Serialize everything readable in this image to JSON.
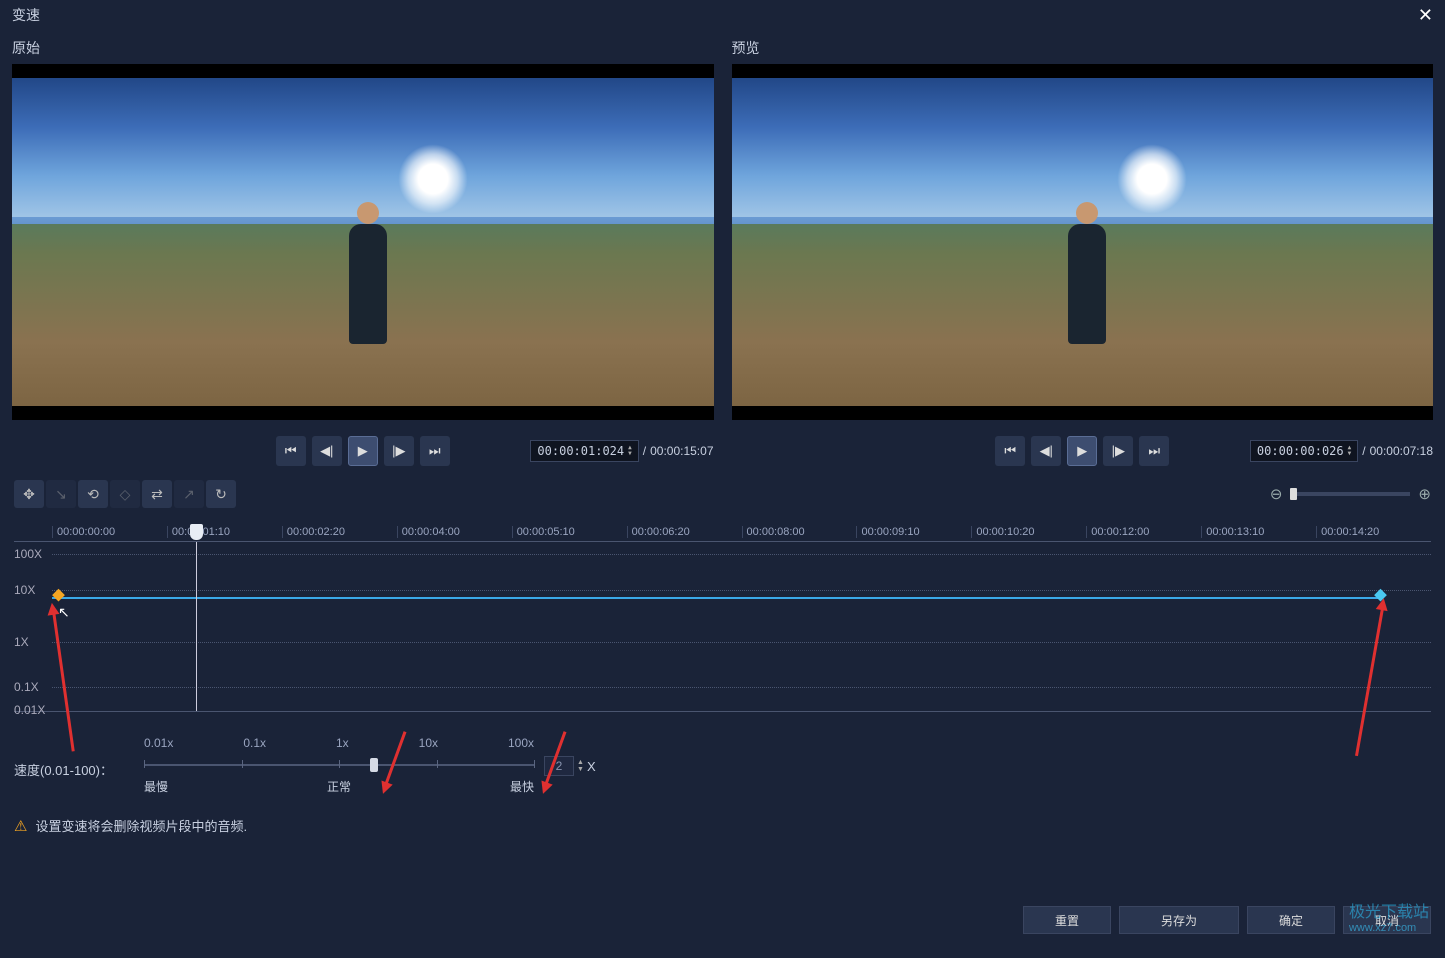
{
  "dialog": {
    "title": "变速",
    "close": "✕"
  },
  "panels": {
    "original_label": "原始",
    "preview_label": "预览"
  },
  "playback": {
    "original": {
      "tc": "00:00:01:024",
      "duration": "00:00:15:07"
    },
    "preview": {
      "tc": "00:00:00:026",
      "duration": "00:00:07:18"
    }
  },
  "toolbar_icons": [
    "✥",
    "↘",
    "⟲",
    "◇",
    "⇄",
    "↗",
    "↻"
  ],
  "ruler": [
    "00:00:00:00",
    "00:00:01:10",
    "00:00:02:20",
    "00:00:04:00",
    "00:00:05:10",
    "00:00:06:20",
    "00:00:08:00",
    "00:00:09:10",
    "00:00:10:20",
    "00:00:12:00",
    "00:00:13:10",
    "00:00:14:20"
  ],
  "graph_labels": [
    "100X",
    "10X",
    "1X",
    "0.1X",
    "0.01X"
  ],
  "slider": {
    "ticks": [
      "0.01x",
      "0.1x",
      "1x",
      "10x",
      "100x"
    ],
    "label": "速度(0.01-100)：",
    "value": "2",
    "suffix": "X",
    "bottoms": [
      "最慢",
      "正常",
      "最快"
    ]
  },
  "warning": "设置变速将会删除视频片段中的音频.",
  "buttons": {
    "reset": "重置",
    "saveas": "另存为",
    "ok": "确定",
    "cancel": "取消"
  },
  "watermark": {
    "brand": "极光下载站",
    "url": "www.xz7.com"
  }
}
